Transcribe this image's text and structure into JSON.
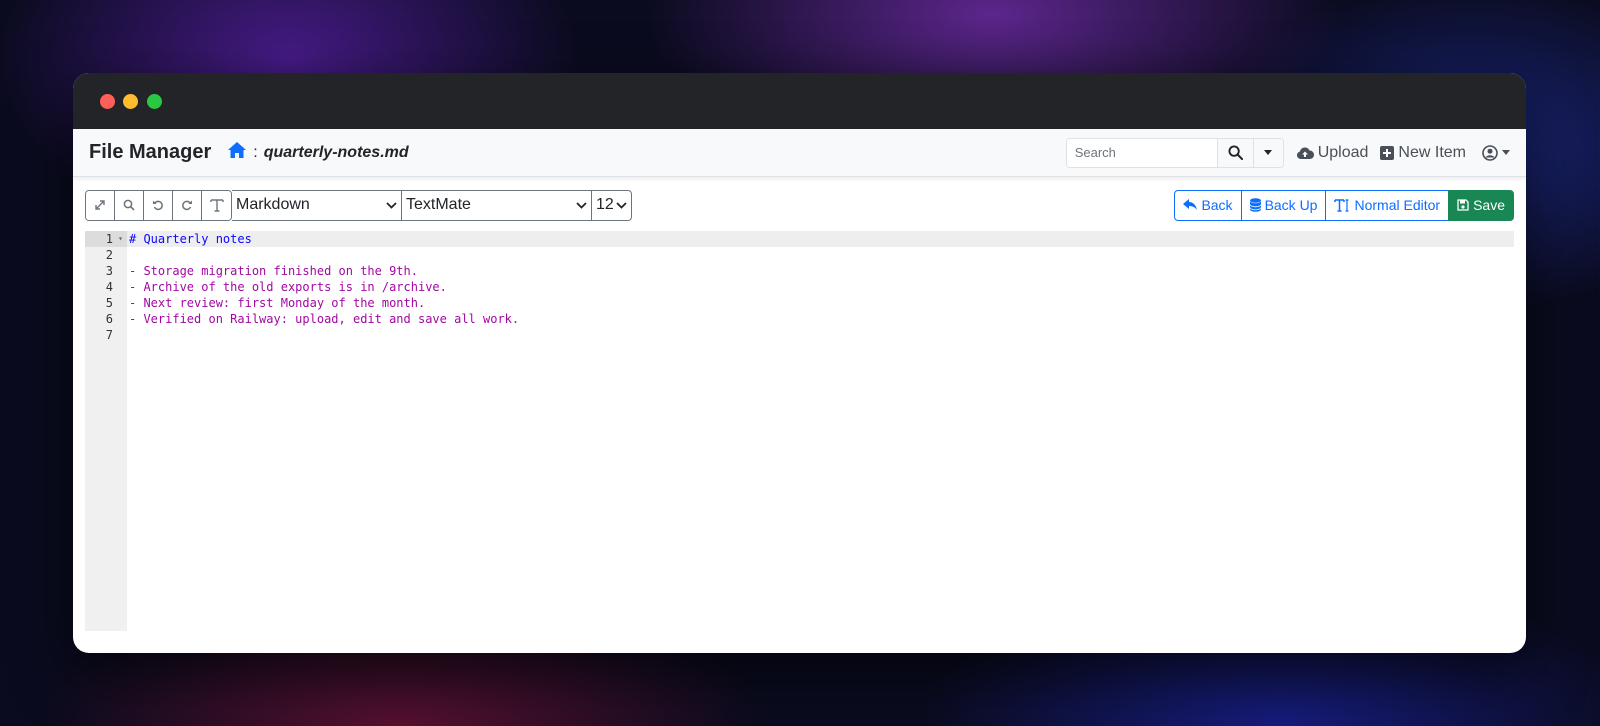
{
  "navbar": {
    "brand": "File Manager",
    "breadcrumb_sep": ":",
    "filename": "quarterly-notes.md",
    "search_placeholder": "Search",
    "upload_label": "Upload",
    "new_item_label": "New Item"
  },
  "toolbar": {
    "mode": "Markdown",
    "theme": "TextMate",
    "font_size": "12",
    "back_label": "Back",
    "backup_label": "Back Up",
    "normal_editor_label": "Normal Editor",
    "save_label": "Save"
  },
  "editor": {
    "lines": [
      {
        "num": "1",
        "text": "# Quarterly notes",
        "kind": "heading"
      },
      {
        "num": "2",
        "text": "",
        "kind": "plain"
      },
      {
        "num": "3",
        "text": "- Storage migration finished on the 9th.",
        "kind": "listitem"
      },
      {
        "num": "4",
        "text": "- Archive of the old exports is in /archive.",
        "kind": "listitem"
      },
      {
        "num": "5",
        "text": "- Next review: first Monday of the month.",
        "kind": "listitem"
      },
      {
        "num": "6",
        "text": "- Verified on Railway: upload, edit and save all work.",
        "kind": "listitem"
      },
      {
        "num": "7",
        "text": "",
        "kind": "plain"
      }
    ]
  },
  "colors": {
    "primary": "#0d6efd",
    "save_green": "#198754",
    "md_heading": "#0c07ff",
    "md_list": "#a109a1"
  }
}
